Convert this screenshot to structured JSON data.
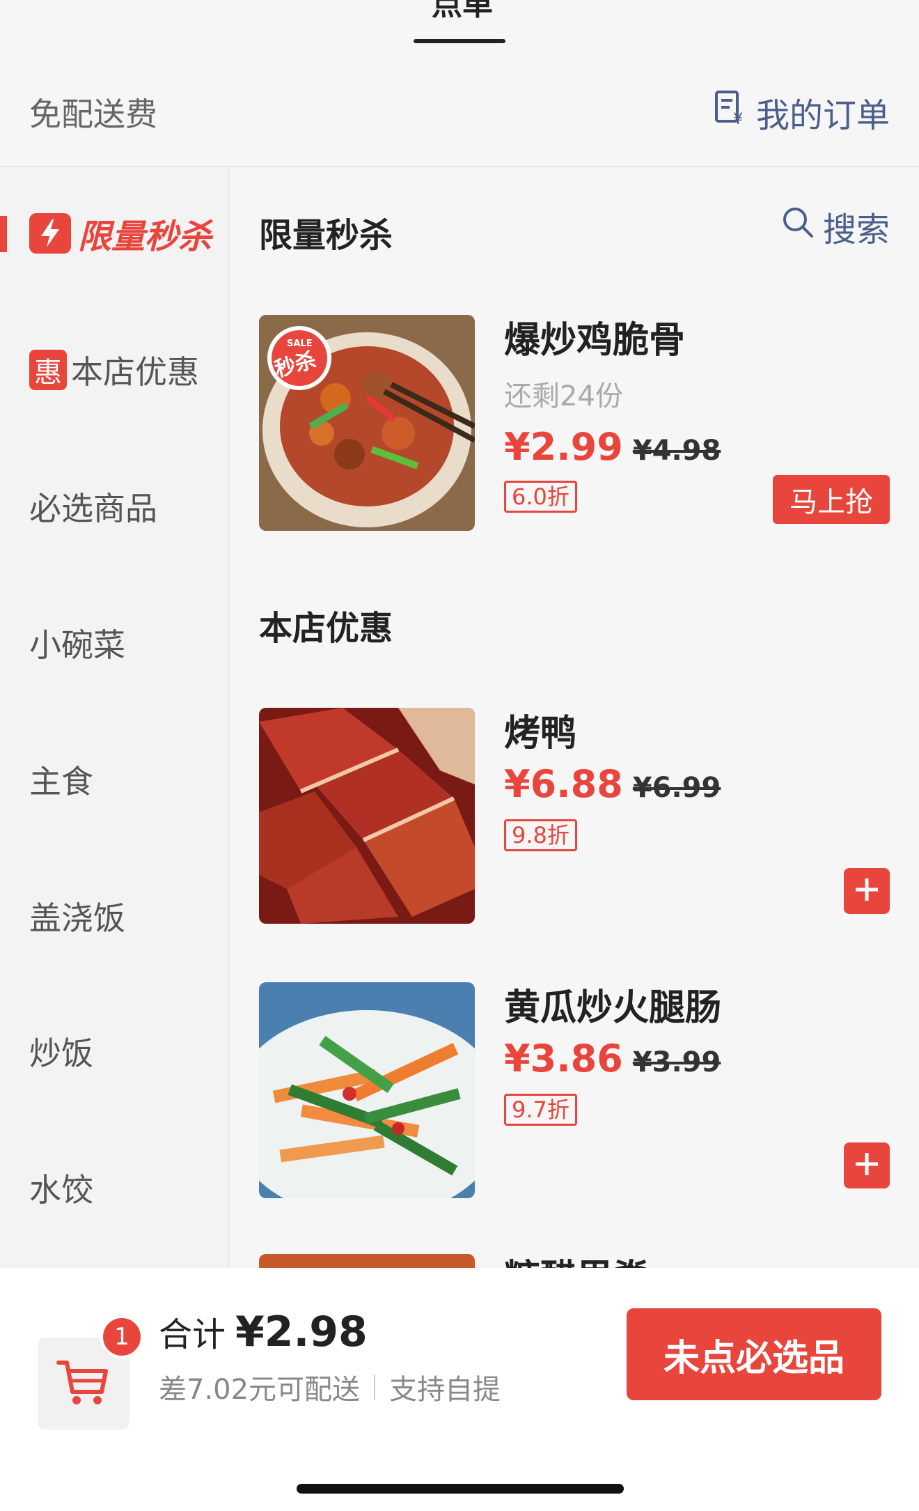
{
  "top": {
    "tab_label": "点单"
  },
  "info_bar": {
    "delivery_fee": "免配送费",
    "my_orders": "我的订单"
  },
  "sidebar": {
    "items": [
      {
        "label": "限量秒杀",
        "active": true
      },
      {
        "label": "本店优惠",
        "badge": "惠"
      },
      {
        "label": "必选商品"
      },
      {
        "label": "小碗菜"
      },
      {
        "label": "主食"
      },
      {
        "label": "盖浇饭"
      },
      {
        "label": "炒饭"
      },
      {
        "label": "水饺"
      }
    ]
  },
  "search": {
    "label": "搜索"
  },
  "sections": [
    {
      "title": "限量秒杀",
      "products": [
        {
          "name": "爆炒鸡脆骨",
          "stock": "还剩24份",
          "price": "¥2.99",
          "old_price": "¥4.98",
          "discount": "6.0折",
          "action": "马上抢",
          "image_badge_small": "SALE",
          "image_badge": "秒杀"
        }
      ]
    },
    {
      "title": "本店优惠",
      "products": [
        {
          "name": "烤鸭",
          "price": "¥6.88",
          "old_price": "¥6.99",
          "discount": "9.8折"
        },
        {
          "name": "黄瓜炒火腿肠",
          "price": "¥3.86",
          "old_price": "¥3.99",
          "discount": "9.7折"
        },
        {
          "name": "糖醋里脊"
        }
      ]
    }
  ],
  "cart": {
    "count": "1",
    "total_label": "合计",
    "total_value": "¥2.98",
    "delivery_note": "差7.02元可配送",
    "pickup_note": "支持自提",
    "checkout_label": "未点必选品"
  },
  "colors": {
    "accent": "#e8453c",
    "link": "#4a5f8a",
    "sidebar_bg": "#f3f3f3"
  }
}
